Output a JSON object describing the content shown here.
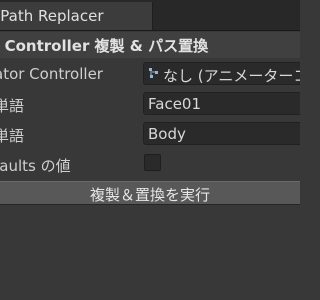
{
  "window": {
    "tab_title": "n Path Replacer"
  },
  "section": {
    "title": "r Controller 複製 & パス置換"
  },
  "fields": {
    "animator_controller": {
      "label": "ator Controller",
      "value": "なし (アニメーターコ",
      "icon": "animator-controller-icon"
    },
    "from_word": {
      "label": "単語",
      "value": "Face01"
    },
    "to_word": {
      "label": "単語",
      "value": "Body"
    },
    "write_defaults": {
      "label": "faults の値",
      "checked": false
    }
  },
  "actions": {
    "execute_label": "複製＆置換を実行"
  },
  "colors": {
    "background": "#383838",
    "field_background": "#2a2a2a",
    "button_background": "#585858",
    "text": "#d2d2d2"
  }
}
